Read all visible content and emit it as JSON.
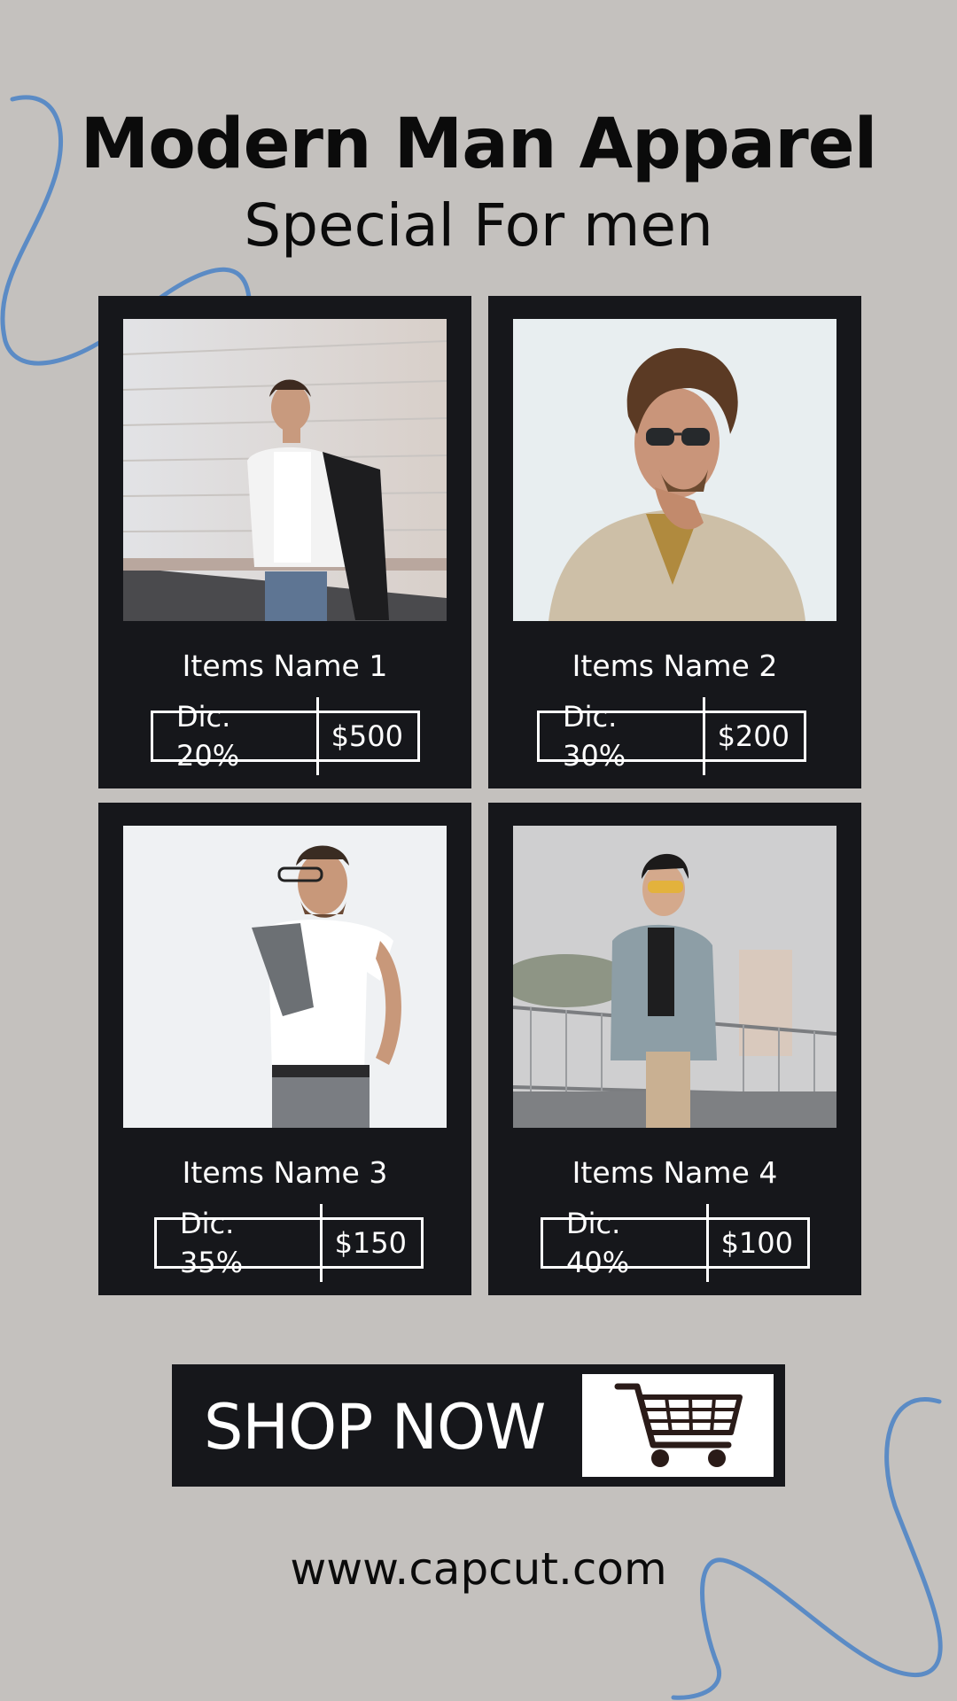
{
  "header": {
    "title": "Modern Man Apparel",
    "subtitle": "Special For men"
  },
  "products": [
    {
      "name": "Items Name 1",
      "discount": "Dic. 20%",
      "price": "$500"
    },
    {
      "name": "Items Name 2",
      "discount": "Dic. 30%",
      "price": "$200"
    },
    {
      "name": "Items Name 3",
      "discount": "Dic. 35%",
      "price": "$150"
    },
    {
      "name": "Items Name 4",
      "discount": "Dic. 40%",
      "price": "$100"
    }
  ],
  "cta": {
    "label": "SHOP NOW",
    "icon": "shopping-cart-icon"
  },
  "footer": {
    "url": "www.capcut.com"
  },
  "colors": {
    "background": "#c4c1be",
    "card": "#16171b",
    "accent_line": "#5b8bc5",
    "text": "#ffffff"
  }
}
